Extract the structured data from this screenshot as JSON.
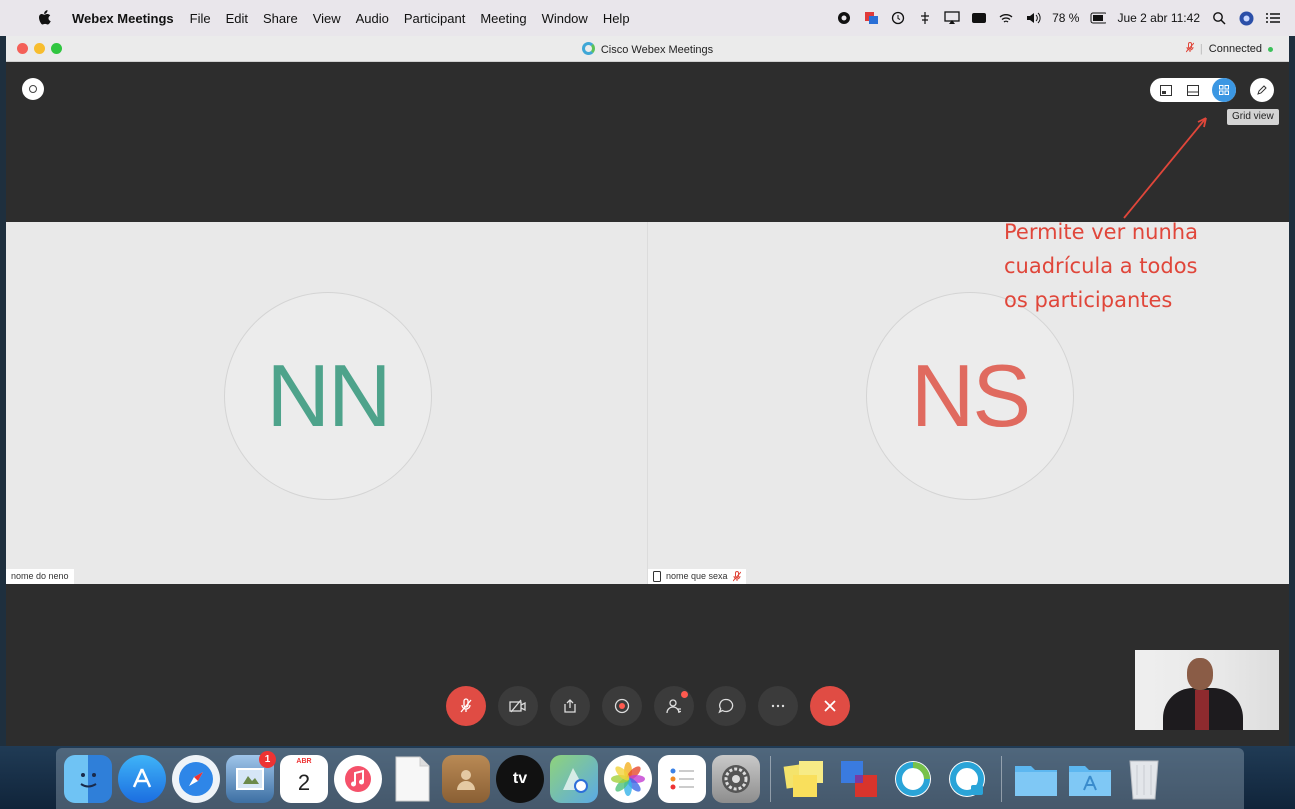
{
  "menubar": {
    "app_name": "Webex Meetings",
    "menus": [
      "File",
      "Edit",
      "Share",
      "View",
      "Audio",
      "Participant",
      "Meeting",
      "Window",
      "Help"
    ],
    "battery": "78 %",
    "datetime": "Jue 2 abr  11:42"
  },
  "window": {
    "title": "Cisco Webex Meetings",
    "status": "Connected"
  },
  "toolbar": {
    "tooltip": "Grid view"
  },
  "participants": [
    {
      "initials": "NN",
      "name": "nome do neno",
      "color": "#4ea38b"
    },
    {
      "initials": "NS",
      "name": "nome que sexa",
      "color": "#e06a5f"
    }
  ],
  "annotation": {
    "lines": [
      "Permite ver nunha",
      "cuadrícula a todos",
      "os participantes"
    ],
    "color": "#e0463a"
  },
  "controls": [
    {
      "icon": "mic-muted-icon"
    },
    {
      "icon": "video-off-icon"
    },
    {
      "icon": "share-icon"
    },
    {
      "icon": "record-icon"
    },
    {
      "icon": "participants-icon"
    },
    {
      "icon": "chat-icon"
    },
    {
      "icon": "more-icon"
    },
    {
      "icon": "leave-icon"
    }
  ],
  "dock": {
    "mail_badge": "1",
    "calendar_month": "ABR",
    "calendar_day": "2",
    "tv_label": "tv"
  }
}
